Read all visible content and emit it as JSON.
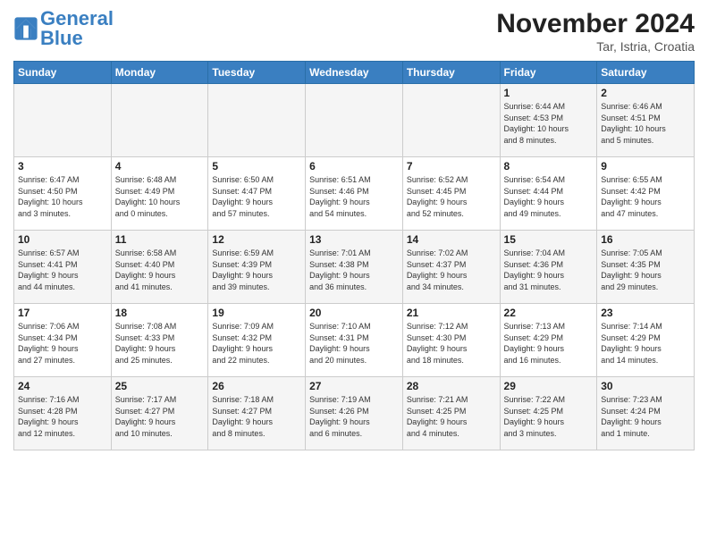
{
  "header": {
    "logo_line1": "General",
    "logo_line2": "Blue",
    "month_title": "November 2024",
    "location": "Tar, Istria, Croatia"
  },
  "days_of_week": [
    "Sunday",
    "Monday",
    "Tuesday",
    "Wednesday",
    "Thursday",
    "Friday",
    "Saturday"
  ],
  "weeks": [
    [
      {
        "day": "",
        "info": ""
      },
      {
        "day": "",
        "info": ""
      },
      {
        "day": "",
        "info": ""
      },
      {
        "day": "",
        "info": ""
      },
      {
        "day": "",
        "info": ""
      },
      {
        "day": "1",
        "info": "Sunrise: 6:44 AM\nSunset: 4:53 PM\nDaylight: 10 hours\nand 8 minutes."
      },
      {
        "day": "2",
        "info": "Sunrise: 6:46 AM\nSunset: 4:51 PM\nDaylight: 10 hours\nand 5 minutes."
      }
    ],
    [
      {
        "day": "3",
        "info": "Sunrise: 6:47 AM\nSunset: 4:50 PM\nDaylight: 10 hours\nand 3 minutes."
      },
      {
        "day": "4",
        "info": "Sunrise: 6:48 AM\nSunset: 4:49 PM\nDaylight: 10 hours\nand 0 minutes."
      },
      {
        "day": "5",
        "info": "Sunrise: 6:50 AM\nSunset: 4:47 PM\nDaylight: 9 hours\nand 57 minutes."
      },
      {
        "day": "6",
        "info": "Sunrise: 6:51 AM\nSunset: 4:46 PM\nDaylight: 9 hours\nand 54 minutes."
      },
      {
        "day": "7",
        "info": "Sunrise: 6:52 AM\nSunset: 4:45 PM\nDaylight: 9 hours\nand 52 minutes."
      },
      {
        "day": "8",
        "info": "Sunrise: 6:54 AM\nSunset: 4:44 PM\nDaylight: 9 hours\nand 49 minutes."
      },
      {
        "day": "9",
        "info": "Sunrise: 6:55 AM\nSunset: 4:42 PM\nDaylight: 9 hours\nand 47 minutes."
      }
    ],
    [
      {
        "day": "10",
        "info": "Sunrise: 6:57 AM\nSunset: 4:41 PM\nDaylight: 9 hours\nand 44 minutes."
      },
      {
        "day": "11",
        "info": "Sunrise: 6:58 AM\nSunset: 4:40 PM\nDaylight: 9 hours\nand 41 minutes."
      },
      {
        "day": "12",
        "info": "Sunrise: 6:59 AM\nSunset: 4:39 PM\nDaylight: 9 hours\nand 39 minutes."
      },
      {
        "day": "13",
        "info": "Sunrise: 7:01 AM\nSunset: 4:38 PM\nDaylight: 9 hours\nand 36 minutes."
      },
      {
        "day": "14",
        "info": "Sunrise: 7:02 AM\nSunset: 4:37 PM\nDaylight: 9 hours\nand 34 minutes."
      },
      {
        "day": "15",
        "info": "Sunrise: 7:04 AM\nSunset: 4:36 PM\nDaylight: 9 hours\nand 31 minutes."
      },
      {
        "day": "16",
        "info": "Sunrise: 7:05 AM\nSunset: 4:35 PM\nDaylight: 9 hours\nand 29 minutes."
      }
    ],
    [
      {
        "day": "17",
        "info": "Sunrise: 7:06 AM\nSunset: 4:34 PM\nDaylight: 9 hours\nand 27 minutes."
      },
      {
        "day": "18",
        "info": "Sunrise: 7:08 AM\nSunset: 4:33 PM\nDaylight: 9 hours\nand 25 minutes."
      },
      {
        "day": "19",
        "info": "Sunrise: 7:09 AM\nSunset: 4:32 PM\nDaylight: 9 hours\nand 22 minutes."
      },
      {
        "day": "20",
        "info": "Sunrise: 7:10 AM\nSunset: 4:31 PM\nDaylight: 9 hours\nand 20 minutes."
      },
      {
        "day": "21",
        "info": "Sunrise: 7:12 AM\nSunset: 4:30 PM\nDaylight: 9 hours\nand 18 minutes."
      },
      {
        "day": "22",
        "info": "Sunrise: 7:13 AM\nSunset: 4:29 PM\nDaylight: 9 hours\nand 16 minutes."
      },
      {
        "day": "23",
        "info": "Sunrise: 7:14 AM\nSunset: 4:29 PM\nDaylight: 9 hours\nand 14 minutes."
      }
    ],
    [
      {
        "day": "24",
        "info": "Sunrise: 7:16 AM\nSunset: 4:28 PM\nDaylight: 9 hours\nand 12 minutes."
      },
      {
        "day": "25",
        "info": "Sunrise: 7:17 AM\nSunset: 4:27 PM\nDaylight: 9 hours\nand 10 minutes."
      },
      {
        "day": "26",
        "info": "Sunrise: 7:18 AM\nSunset: 4:27 PM\nDaylight: 9 hours\nand 8 minutes."
      },
      {
        "day": "27",
        "info": "Sunrise: 7:19 AM\nSunset: 4:26 PM\nDaylight: 9 hours\nand 6 minutes."
      },
      {
        "day": "28",
        "info": "Sunrise: 7:21 AM\nSunset: 4:25 PM\nDaylight: 9 hours\nand 4 minutes."
      },
      {
        "day": "29",
        "info": "Sunrise: 7:22 AM\nSunset: 4:25 PM\nDaylight: 9 hours\nand 3 minutes."
      },
      {
        "day": "30",
        "info": "Sunrise: 7:23 AM\nSunset: 4:24 PM\nDaylight: 9 hours\nand 1 minute."
      }
    ]
  ]
}
